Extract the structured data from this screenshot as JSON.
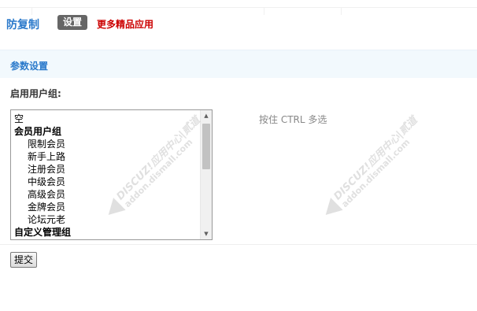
{
  "header": {
    "plugin_title": "防复制",
    "settings_tab": "设置",
    "more_apps_link": "更多精品应用"
  },
  "section": {
    "title": "参数设置"
  },
  "form": {
    "groups_label": "启用用户组:",
    "group_options": [
      {
        "label": "空",
        "kind": "option"
      },
      {
        "label": "会员用户组",
        "kind": "group"
      },
      {
        "label": "限制会员",
        "kind": "child"
      },
      {
        "label": "新手上路",
        "kind": "child"
      },
      {
        "label": "注册会员",
        "kind": "child"
      },
      {
        "label": "中级会员",
        "kind": "child"
      },
      {
        "label": "高级会员",
        "kind": "child"
      },
      {
        "label": "金牌会员",
        "kind": "child"
      },
      {
        "label": "论坛元老",
        "kind": "child"
      },
      {
        "label": "自定义管理组",
        "kind": "group"
      }
    ],
    "hint": "按住 CTRL 多选",
    "submit_label": "提交"
  },
  "watermark": {
    "line1": "DISCUZ!应用中心|贰道",
    "line2": "addon.dismall.com"
  },
  "colors": {
    "accent_blue": "#2b7acb",
    "link_red": "#cc0000",
    "tab_gray": "#666666",
    "section_bg": "#f2f9fd"
  }
}
